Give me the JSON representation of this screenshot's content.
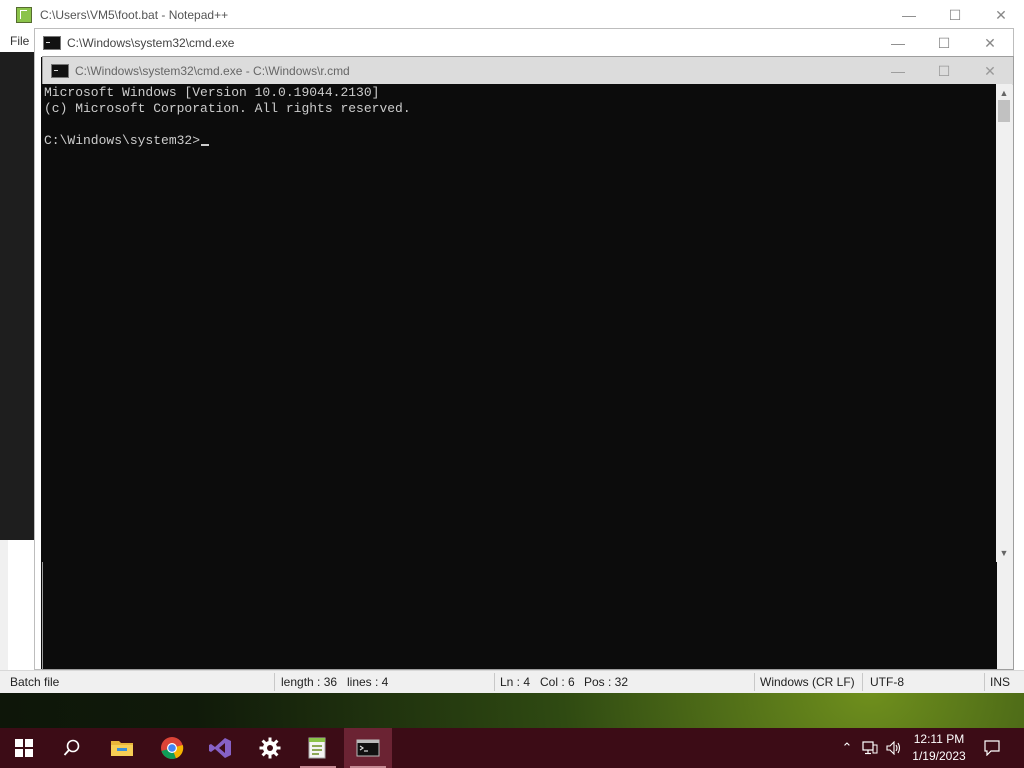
{
  "notepad": {
    "title": "C:\\Users\\VM5\\foot.bat - Notepad++",
    "menu_first": "File",
    "status": {
      "file_type": "Batch file",
      "length": "length : 36",
      "lines": "lines : 4",
      "ln": "Ln : 4",
      "col": "Col : 6",
      "pos": "Pos : 32",
      "eol": "Windows (CR LF)",
      "encoding": "UTF-8",
      "mode": "INS"
    }
  },
  "cmd_window_1": {
    "title": "C:\\Windows\\system32\\cmd.exe"
  },
  "cmd_window_2": {
    "title": "C:\\Windows\\system32\\cmd.exe - C:\\Windows\\r.cmd"
  },
  "console": {
    "ghost_line": "Microsoft Windows [Version 10.0.19044.2130]",
    "line1": "Microsoft Windows [Version 10.0.19044.2130]",
    "line2": "(c) Microsoft Corporation. All rights reserved.",
    "prompt": "C:\\Windows\\system32>"
  },
  "taskbar": {
    "apps": [
      {
        "name": "start",
        "icon": "windows-logo-icon"
      },
      {
        "name": "search",
        "icon": "search-icon"
      },
      {
        "name": "file-explorer",
        "icon": "folder-icon"
      },
      {
        "name": "chrome",
        "icon": "chrome-icon"
      },
      {
        "name": "visual-studio",
        "icon": "visual-studio-icon"
      },
      {
        "name": "settings",
        "icon": "gear-icon"
      },
      {
        "name": "notepad-plus-plus",
        "icon": "notepadpp-icon"
      },
      {
        "name": "command-prompt",
        "icon": "cmd-icon"
      }
    ],
    "time": "12:11 PM",
    "date": "1/19/2023"
  },
  "colors": {
    "taskbar_bg": "#3c0c16",
    "taskbar_active": "#6b2333",
    "console_bg": "#0c0c0c",
    "console_fg": "#cccccc"
  }
}
